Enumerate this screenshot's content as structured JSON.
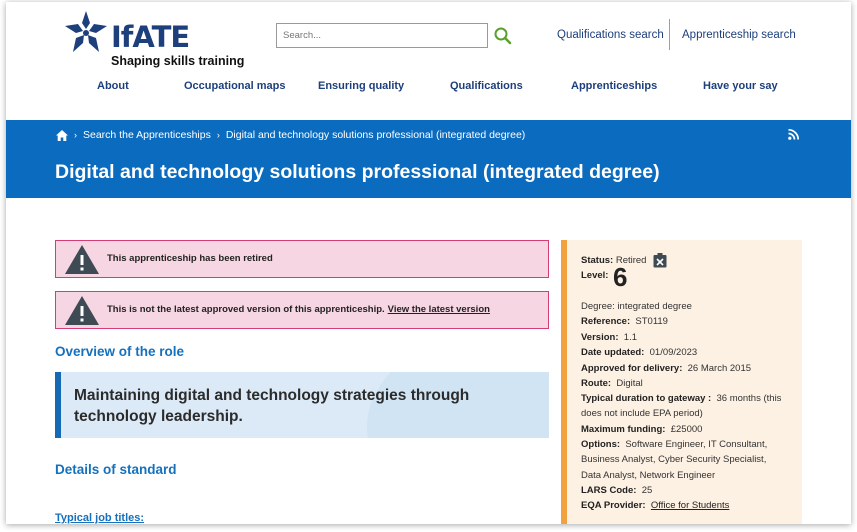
{
  "header": {
    "brand": "IfATE",
    "tagline": "Shaping skills training",
    "search_placeholder": "Search...",
    "links": [
      "Qualifications search",
      "Apprenticeship search"
    ],
    "nav": [
      "About",
      "Occupational maps",
      "Ensuring quality",
      "Qualifications",
      "Apprenticeships",
      "Have your say"
    ]
  },
  "banner": {
    "breadcrumbs": [
      "Search the Apprenticeships",
      "Digital and technology solutions professional (integrated degree)"
    ],
    "title": "Digital and technology solutions professional (integrated degree)"
  },
  "alerts": {
    "retired": "This apprenticeship has been retired",
    "not_latest": "This is not the latest approved version of this apprenticeship.",
    "not_latest_link": "View the latest version"
  },
  "main": {
    "overview_heading": "Overview of the role",
    "overview_quote": "Maintaining digital and technology strategies through technology leadership.",
    "details_heading": "Details of standard",
    "job_titles_heading": "Typical job titles:"
  },
  "sidebar": {
    "status_label": "Status:",
    "status_value": "Retired",
    "level_label": "Level:",
    "level_value": "6",
    "degree": "Degree: integrated degree",
    "reference_label": "Reference:",
    "reference_value": "ST0119",
    "version_label": "Version:",
    "version_value": "1.1",
    "date_updated_label": "Date updated:",
    "date_updated_value": "01/09/2023",
    "approved_label": "Approved for delivery:",
    "approved_value": "26 March 2015",
    "route_label": "Route:",
    "route_value": "Digital",
    "duration_label": "Typical duration to gateway :",
    "duration_value_1": "36 months (this",
    "duration_value_2": "does not include EPA period)",
    "funding_label": "Maximum funding:",
    "funding_value": "£25000",
    "options_label": "Options:",
    "options_value_1": "Software Engineer, IT Consultant,",
    "options_value_2": "Business Analyst, Cyber Security Specialist,",
    "options_value_3": "Data Analyst, Network Engineer",
    "lars_label": "LARS Code:",
    "lars_value": "25",
    "eqa_label": "EQA Provider:",
    "eqa_value": "Office for Students"
  },
  "colors": {
    "brand_navy": "#1d3f7c",
    "banner_blue": "#0b6bbf",
    "alert_pink": "#f6d6e2",
    "alert_border": "#d43d76",
    "sidebar_bg": "#fdf1e3",
    "sidebar_accent": "#f2a13f"
  }
}
